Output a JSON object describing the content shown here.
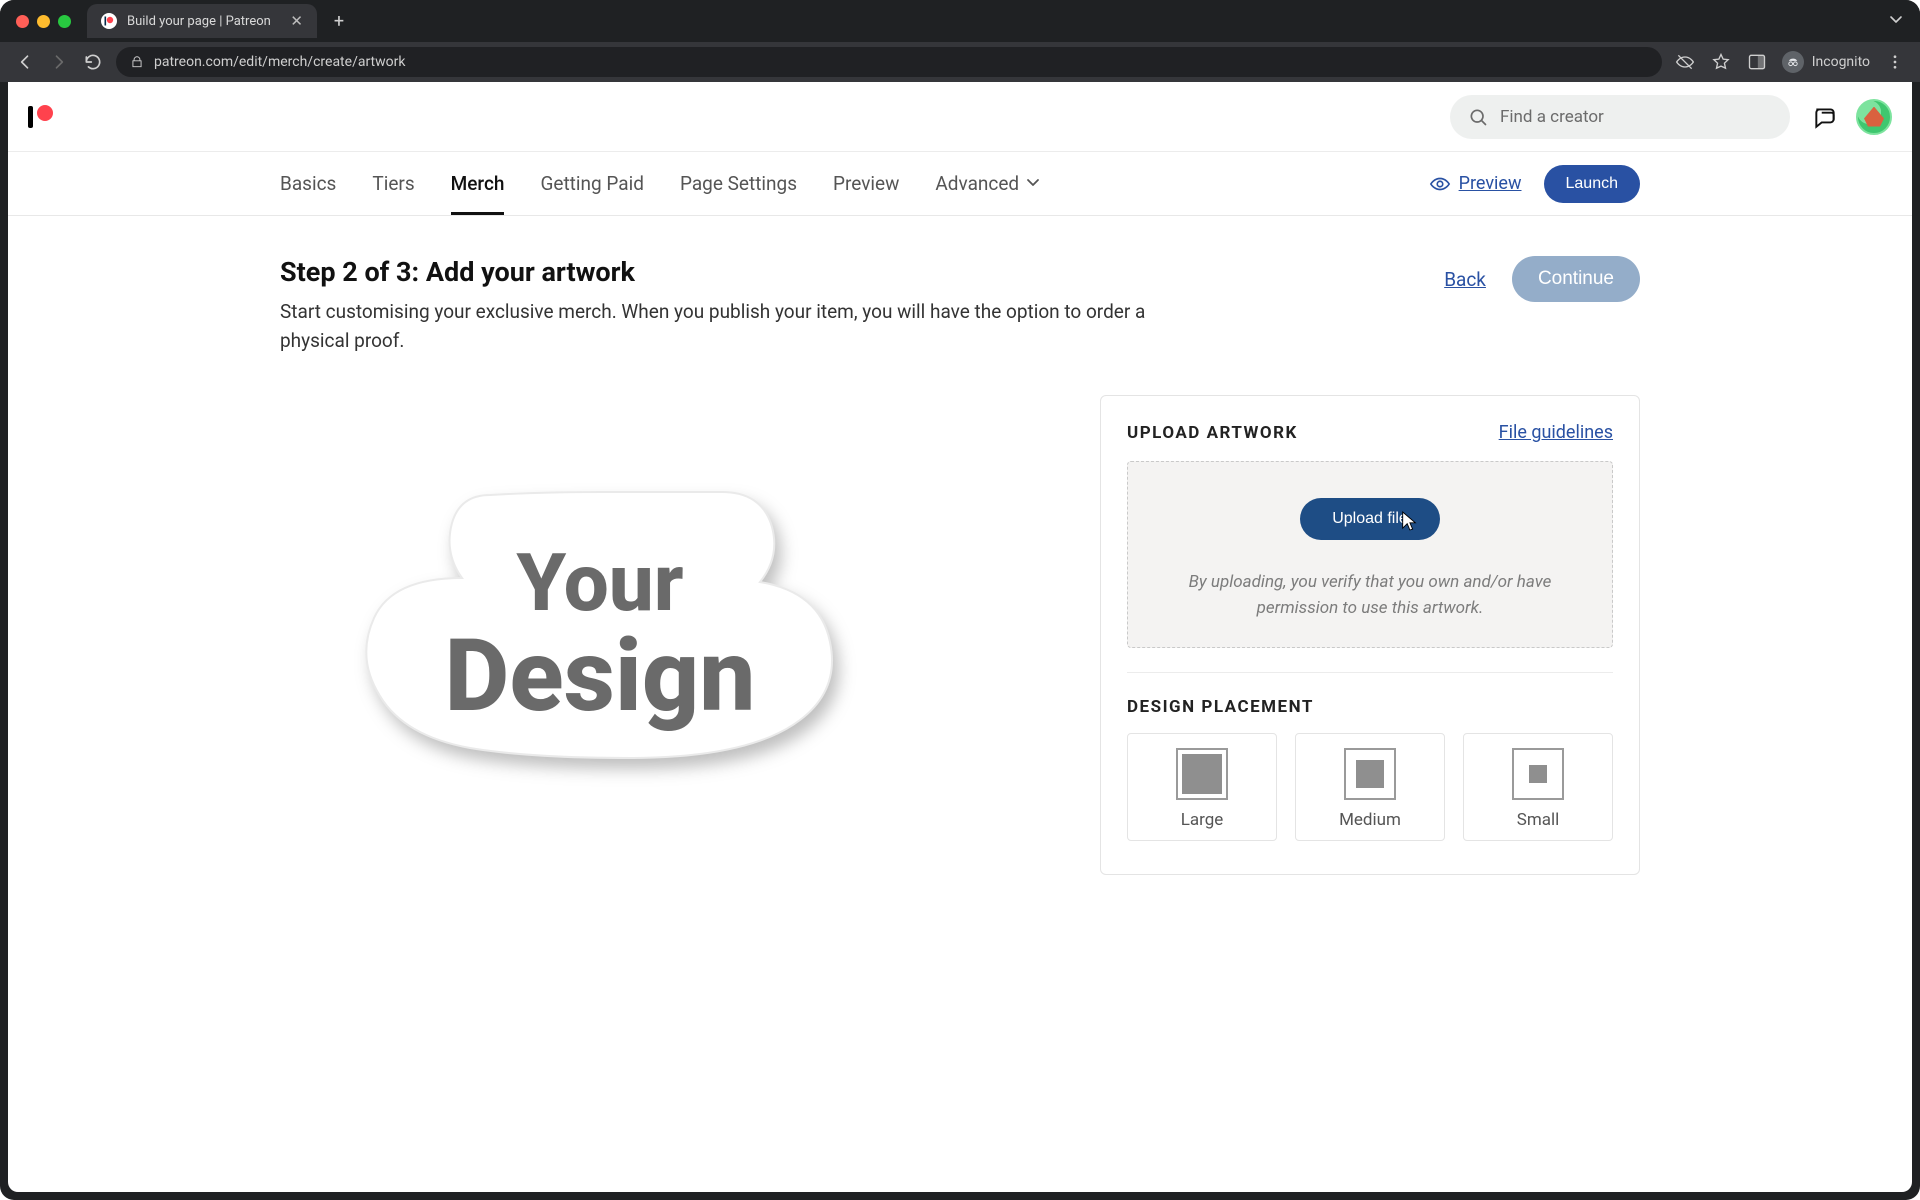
{
  "browser": {
    "tab_title": "Build your page | Patreon",
    "url": "patreon.com/edit/merch/create/artwork",
    "incognito_label": "Incognito"
  },
  "header": {
    "search_placeholder": "Find a creator"
  },
  "nav": {
    "tabs": [
      "Basics",
      "Tiers",
      "Merch",
      "Getting Paid",
      "Page Settings",
      "Preview",
      "Advanced"
    ],
    "active": "Merch",
    "preview_label": "Preview",
    "launch_label": "Launch"
  },
  "step": {
    "title": "Step 2 of 3: Add your artwork",
    "description": "Start customising your exclusive merch. When you publish your item, you will have the option to order a physical proof.",
    "back_label": "Back",
    "continue_label": "Continue"
  },
  "preview": {
    "line1": "Your",
    "line2": "Design"
  },
  "upload": {
    "section_title": "UPLOAD ARTWORK",
    "guidelines_link": "File guidelines",
    "button_label": "Upload file",
    "disclaimer": "By uploading, you verify that you own and/or have permission to use this artwork."
  },
  "placement": {
    "section_title": "DESIGN PLACEMENT",
    "options": {
      "large": "Large",
      "medium": "Medium",
      "small": "Small"
    }
  }
}
